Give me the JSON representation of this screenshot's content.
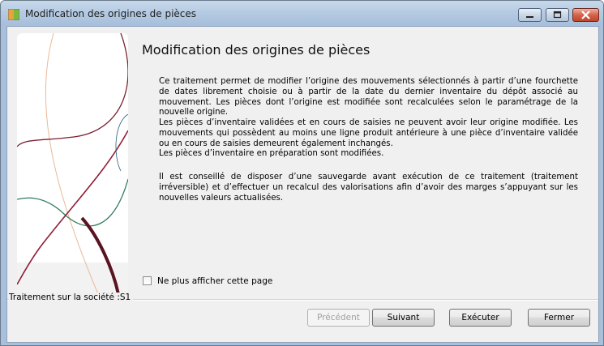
{
  "window": {
    "title": "Modification des origines de pièces"
  },
  "main": {
    "heading": "Modification des origines de pièces",
    "paragraphs": [
      "Ce traitement permet de modifier l’origine des mouvements sélectionnés à partir d’une fourchette de dates librement choisie ou à partir de la date du dernier inventaire du dépôt associé au mouvement.  Les pièces dont l’origine est modifiée sont recalculées selon le paramétrage de la nouvelle origine.",
      "Les pièces d’inventaire validées et en cours de saisies ne peuvent avoir leur origine modifiée. Les mouvements qui possèdent au moins une ligne produit antérieure à une pièce d’inventaire validée ou en cours de saisies demeurent également inchangés.",
      "Les pièces d’inventaire en préparation sont modifiées.",
      "Il est conseillé de disposer d’une sauvegarde avant exécution de ce traitement (traitement irréversible) et d’effectuer un recalcul des valorisations afin d’avoir des marges s’appuyant sur les nouvelles valeurs actualisées."
    ],
    "checkbox_label": "Ne plus afficher cette page",
    "checkbox_checked": false
  },
  "footer": {
    "group_label": "Traitement sur la société :S1",
    "buttons": {
      "previous": "Précédent",
      "next": "Suivant",
      "execute": "Exécuter",
      "close": "Fermer"
    }
  }
}
